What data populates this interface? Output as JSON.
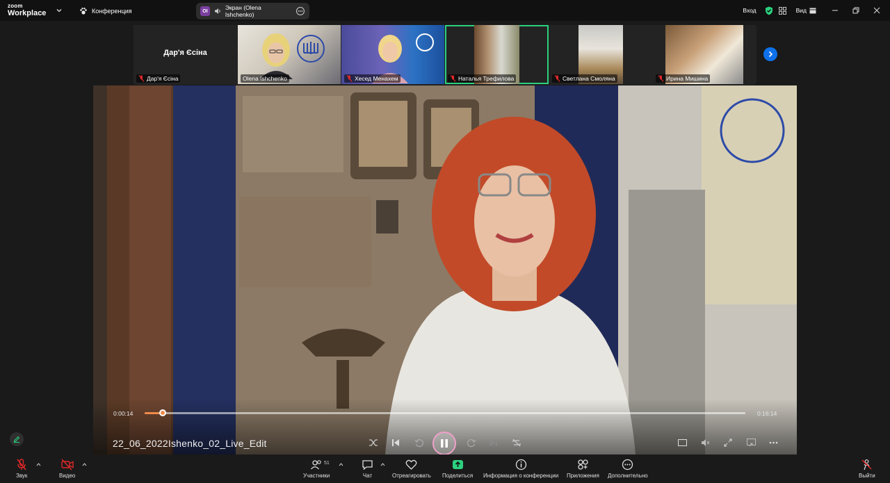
{
  "app": {
    "logo_line1": "zoom",
    "logo_line2": "Workplace"
  },
  "topbar": {
    "meeting_label": "Конференция",
    "screen_tab_badge": "OI",
    "screen_tab_label": "Экран (Olena Ishchenko)",
    "signin_label": "Вход",
    "view_label": "Вид"
  },
  "gallery": {
    "participants": [
      {
        "name": "Дар'я Єсіна",
        "center_name": "Дар'я Єсіна",
        "muted": true
      },
      {
        "name": "Olena Ishchenko",
        "muted": false
      },
      {
        "name": "Хесед Менахем",
        "muted": true
      },
      {
        "name": "Наталья Трефилова",
        "muted": true
      },
      {
        "name": "Светлана Смоляна",
        "muted": true
      },
      {
        "name": "Ирина Мишина",
        "muted": true
      }
    ]
  },
  "player": {
    "current_time": "0:00:14",
    "total_time": "0:16:14",
    "progress": 0.0144,
    "title": "22_06_2022Ishenko_02_Live_Edit"
  },
  "toolbar": {
    "audio_label": "Звук",
    "video_label": "Видео",
    "participants_count": "51",
    "participants_label": "Участники",
    "chat_label": "Чат",
    "react_label": "Отреагировать",
    "share_label": "Поделиться",
    "info_label": "Информация о конференции",
    "apps_label": "Приложения",
    "more_label": "Дополнительно",
    "leave_label": "Выйти"
  },
  "colors": {
    "accent": "#0e71eb",
    "share_green": "#2bd17e",
    "muted_red": "#e02828",
    "progress": "#f08a4a"
  }
}
